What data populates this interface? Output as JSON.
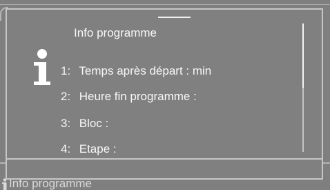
{
  "background": {
    "footer_label": "Info programme",
    "footer_icon": "info-icon"
  },
  "modal": {
    "title": "Info programme",
    "icon": "info-icon",
    "items": [
      {
        "number": "1:",
        "label": "Temps après départ :  min"
      },
      {
        "number": "2:",
        "label": "Heure fin programme :"
      },
      {
        "number": "3:",
        "label": "Bloc :"
      },
      {
        "number": "4:",
        "label": "Etape :"
      }
    ],
    "scroll_position": 0.0,
    "scroll_visible_fraction": 0.5
  },
  "colors": {
    "screen_background": "#7f7f7f",
    "text": "#f7f7f7",
    "frame": "#c6c6c6"
  }
}
